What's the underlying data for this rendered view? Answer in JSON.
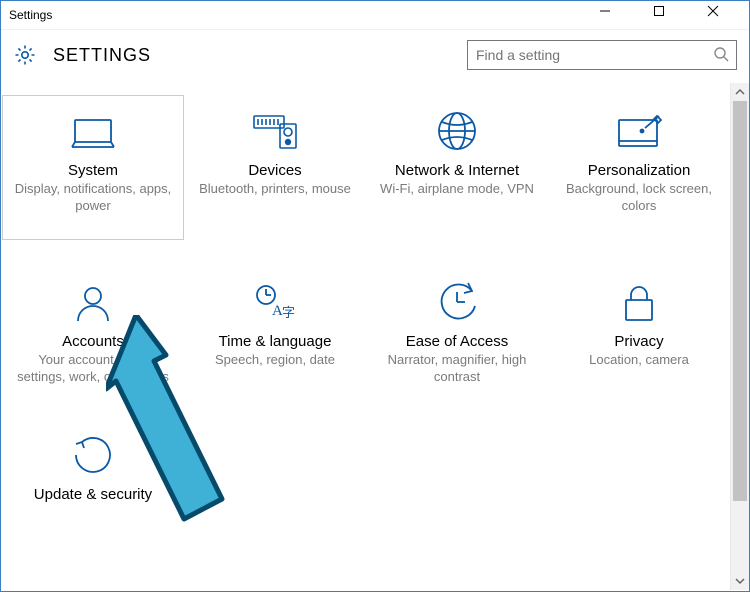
{
  "window": {
    "title": "Settings"
  },
  "header": {
    "title": "SETTINGS",
    "search_placeholder": "Find a setting"
  },
  "tiles": {
    "system": {
      "title": "System",
      "desc": "Display, notifications, apps, power"
    },
    "devices": {
      "title": "Devices",
      "desc": "Bluetooth, printers, mouse"
    },
    "network": {
      "title": "Network & Internet",
      "desc": "Wi-Fi, airplane mode, VPN"
    },
    "personalization": {
      "title": "Personalization",
      "desc": "Background, lock screen, colors"
    },
    "accounts": {
      "title": "Accounts",
      "desc": "Your account, sync settings, work, other users"
    },
    "timelang": {
      "title": "Time & language",
      "desc": "Speech, region, date"
    },
    "ease": {
      "title": "Ease of Access",
      "desc": "Narrator, magnifier, high contrast"
    },
    "privacy": {
      "title": "Privacy",
      "desc": "Location, camera"
    },
    "update": {
      "title": "Update & security",
      "desc": ""
    }
  },
  "colors": {
    "accent": "#0a5aa6",
    "arrow_fill": "#3fb0d6",
    "arrow_stroke": "#064a6b"
  }
}
